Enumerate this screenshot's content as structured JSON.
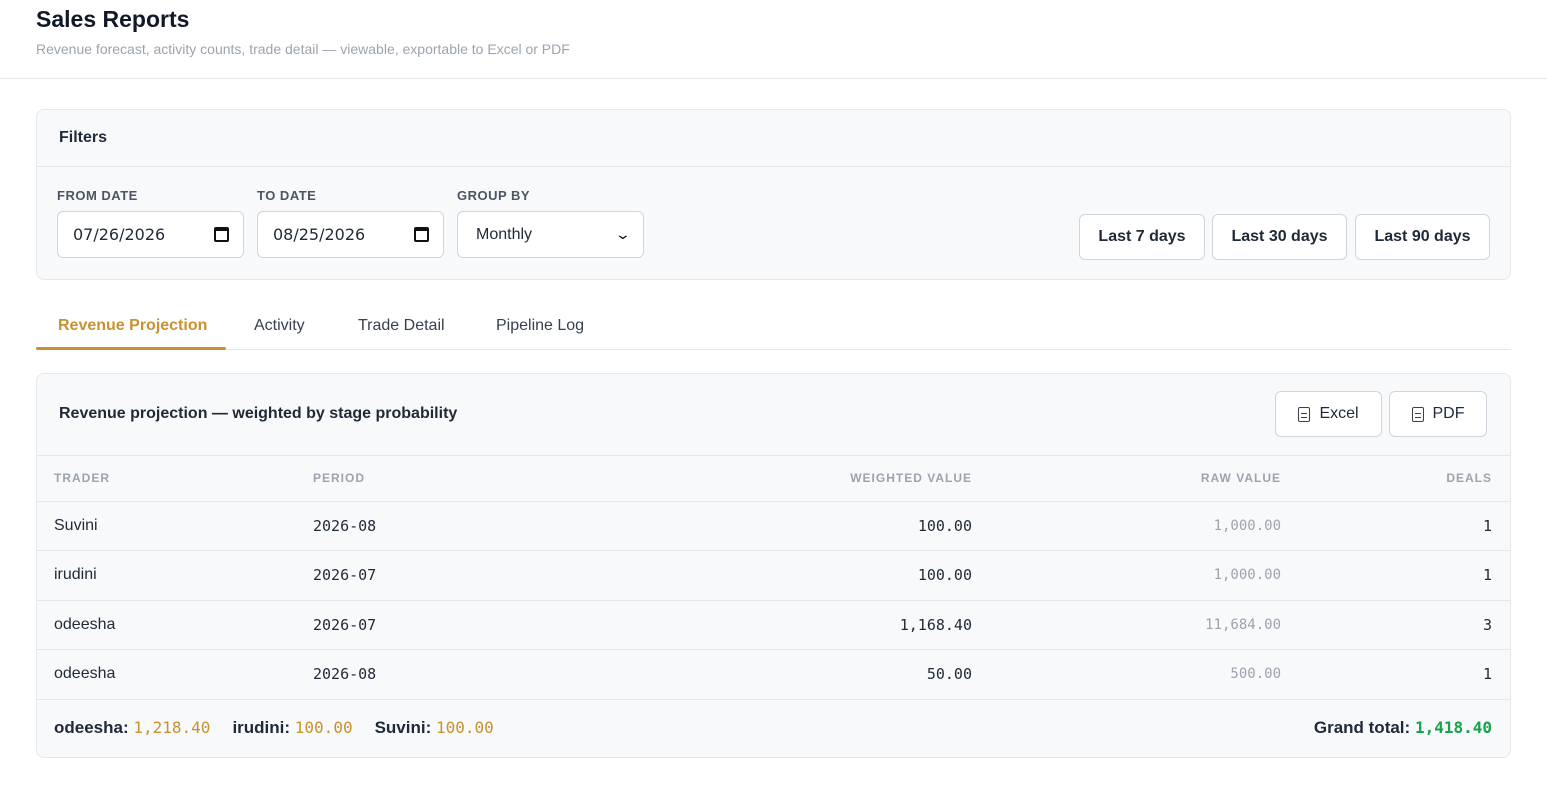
{
  "header": {
    "title": "Sales Reports",
    "subtitle": "Revenue forecast, activity counts, trade detail — viewable, exportable to Excel or PDF"
  },
  "filters": {
    "title": "Filters",
    "from_label": "FROM DATE",
    "from_value": "07/26/2026",
    "to_label": "TO DATE",
    "to_value": "08/25/2026",
    "group_label": "GROUP BY",
    "group_value": "Monthly",
    "ranges": [
      "Last 7 days",
      "Last 30 days",
      "Last 90 days"
    ]
  },
  "tabs": [
    "Revenue Projection",
    "Activity",
    "Trade Detail",
    "Pipeline Log"
  ],
  "active_tab": "Revenue Projection",
  "report": {
    "title": "Revenue projection — weighted by stage probability",
    "export_excel": "Excel",
    "export_pdf": "PDF",
    "columns": [
      "TRADER",
      "PERIOD",
      "WEIGHTED VALUE",
      "RAW VALUE",
      "DEALS"
    ],
    "rows": [
      {
        "trader": "Suvini",
        "period": "2026-08",
        "weighted": "100.00",
        "raw": "1,000.00",
        "deals": "1"
      },
      {
        "trader": "irudini",
        "period": "2026-07",
        "weighted": "100.00",
        "raw": "1,000.00",
        "deals": "1"
      },
      {
        "trader": "odeesha",
        "period": "2026-07",
        "weighted": "1,168.40",
        "raw": "11,684.00",
        "deals": "3"
      },
      {
        "trader": "odeesha",
        "period": "2026-08",
        "weighted": "50.00",
        "raw": "500.00",
        "deals": "1"
      }
    ],
    "totals": [
      {
        "name": "odeesha:",
        "value": "1,218.40"
      },
      {
        "name": "irudini:",
        "value": "100.00"
      },
      {
        "name": "Suvini:",
        "value": "100.00"
      }
    ],
    "grand_label": "Grand total:",
    "grand_value": "1,418.40"
  },
  "colors": {
    "accent": "#c9912f",
    "grand_total": "#16a34a"
  }
}
